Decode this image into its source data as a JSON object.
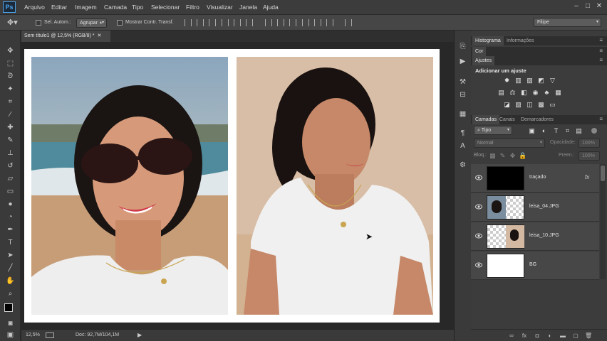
{
  "app": {
    "logo": "Ps"
  },
  "menu": [
    "Arquivo",
    "Editar",
    "Imagem",
    "Camada",
    "Tipo",
    "Selecionar",
    "Filtro",
    "Visualizar",
    "Janela",
    "Ajuda"
  ],
  "options": {
    "auto_select_label": "Sel. Autom.:",
    "auto_select_value": "Agrupar",
    "show_transform_label": "Mostrar Contr. Transf.",
    "workspace": "Filipe"
  },
  "document": {
    "tab_title": "Sem título1 @ 12,5% (RGB/8) *",
    "zoom": "12,5%",
    "doc_info": "Doc: 92,7M/104,1M"
  },
  "panels": {
    "histogram_tab": "Histograma",
    "info_tab": "Informações",
    "color_tab": "Cor",
    "adjustments_tab": "Ajustes",
    "adjustments_heading": "Adicionar um ajuste",
    "layers_tab": "Camadas",
    "channels_tab": "Canais",
    "paths_tab": "Demarcadores",
    "filter_kind": "Tipo",
    "blend_mode": "Normal",
    "opacity_label": "Opacidade:",
    "opacity_value": "100%",
    "lock_label": "Bloq.:",
    "fill_label": "Preen.:",
    "fill_value": "100%"
  },
  "layers": [
    {
      "name": "traçado",
      "fx": "fx",
      "thumb": "black"
    },
    {
      "name": "leisa_04.JPG",
      "thumb": "photo-left"
    },
    {
      "name": "leisa_10.JPG",
      "thumb": "photo-right"
    },
    {
      "name": "BG",
      "thumb": "white"
    }
  ],
  "colors": {
    "accent": "#4ea3e8",
    "panel_bg": "#3c3c3c",
    "canvas_bg": "#282828"
  }
}
